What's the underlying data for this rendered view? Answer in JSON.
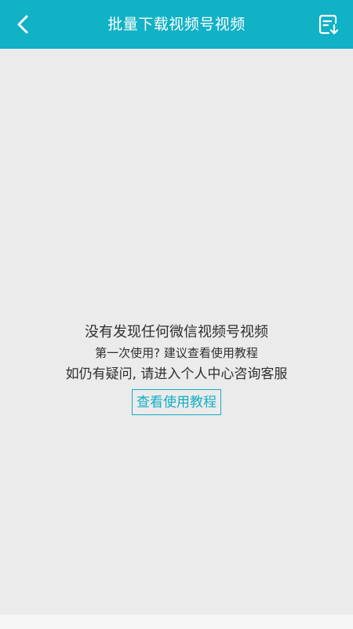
{
  "header": {
    "title": "批量下载视频号视频",
    "back_icon": "chevron-left-icon",
    "action_icon": "download-list-icon"
  },
  "empty_state": {
    "line1": "没有发现任何微信视频号视频",
    "line2": "第一次使用? 建议查看使用教程",
    "line3": "如仍有疑问, 请进入个人中心咨询客服",
    "button_label": "查看使用教程"
  },
  "colors": {
    "header_bg": "#11b1c6",
    "page_bg": "#ebebeb",
    "accent": "#11aec4"
  }
}
